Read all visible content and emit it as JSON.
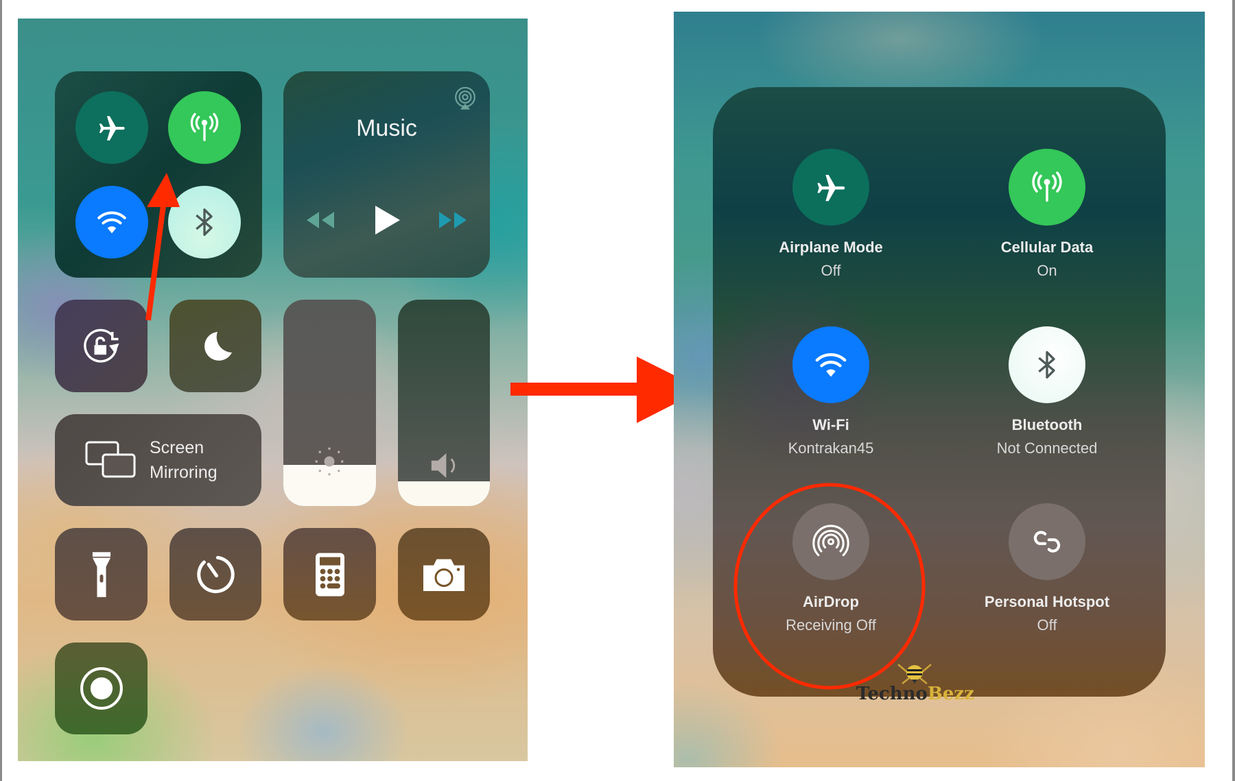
{
  "left_screen": {
    "connectivity": {
      "airplane": {
        "icon": "airplane-icon",
        "state": "off",
        "color": "#0b6f5c"
      },
      "cellular": {
        "icon": "cellular-antenna-icon",
        "state": "on",
        "color": "#34c759"
      },
      "wifi": {
        "icon": "wifi-icon",
        "state": "on",
        "color": "#0a7aff"
      },
      "bluetooth": {
        "icon": "bluetooth-icon",
        "state": "on",
        "color": "#c8f5ea"
      }
    },
    "music": {
      "title": "Music",
      "airplay_icon": "airplay-audio-icon",
      "controls": [
        "rewind-icon",
        "play-icon",
        "fast-forward-icon"
      ]
    },
    "rotation_lock": {
      "icon": "rotation-lock-icon"
    },
    "do_not_disturb": {
      "icon": "moon-icon"
    },
    "screen_mirroring": {
      "line1": "Screen",
      "line2": "Mirroring",
      "icon": "screen-mirroring-icon"
    },
    "brightness": {
      "icon": "sun-icon",
      "level": 0.2
    },
    "volume": {
      "icon": "speaker-icon",
      "level": 0.12
    },
    "shortcuts": [
      {
        "name": "flashlight",
        "icon": "flashlight-icon"
      },
      {
        "name": "timer",
        "icon": "timer-icon"
      },
      {
        "name": "calculator",
        "icon": "calculator-icon"
      },
      {
        "name": "camera",
        "icon": "camera-icon"
      }
    ],
    "screen_recording": {
      "icon": "screen-record-icon"
    }
  },
  "annotations": {
    "arrow_color": "#ff2a00",
    "highlight_color": "#ff2a00"
  },
  "right_screen": {
    "items": [
      {
        "title": "Airplane Mode",
        "status": "Off",
        "icon": "airplane-icon",
        "color": "#0b6f5c"
      },
      {
        "title": "Cellular Data",
        "status": "On",
        "icon": "cellular-antenna-icon",
        "color": "#34c759"
      },
      {
        "title": "Wi-Fi",
        "status": "Kontrakan45",
        "icon": "wifi-icon",
        "color": "#0a7aff"
      },
      {
        "title": "Bluetooth",
        "status": "Not Connected",
        "icon": "bluetooth-icon",
        "color": "#f0fbf8"
      },
      {
        "title": "AirDrop",
        "status": "Receiving Off",
        "icon": "airdrop-icon",
        "color": "#7a6f6a"
      },
      {
        "title": "Personal Hotspot",
        "status": "Off",
        "icon": "hotspot-icon",
        "color": "#7a6f6a"
      }
    ],
    "watermark": {
      "part1": "Techno",
      "part2": "Bezz"
    }
  }
}
